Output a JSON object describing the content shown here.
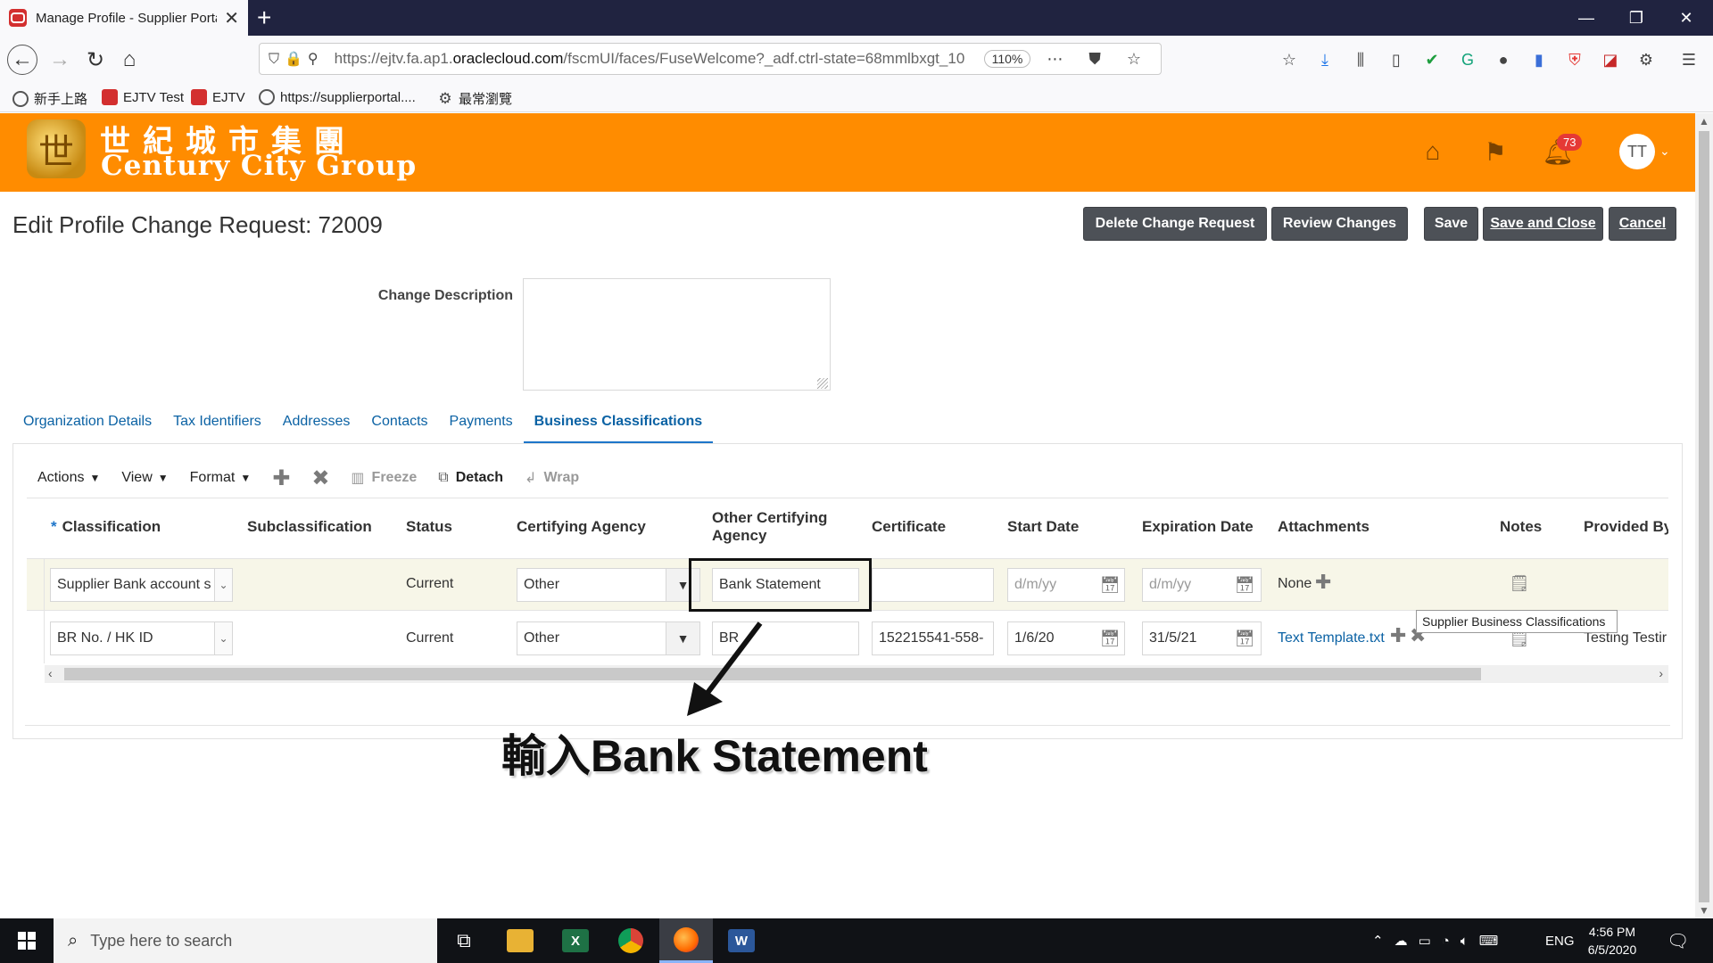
{
  "browser": {
    "tab_title": "Manage Profile - Supplier Portal",
    "url_prefix": "https://ejtv.fa.ap1.",
    "url_domain": "oraclecloud.com",
    "url_suffix": "/fscmUI/faces/FuseWelcome?_adf.ctrl-state=68mmlbxgt_10",
    "zoom": "110%",
    "bookmarks": [
      "新手上路",
      "EJTV Test",
      "EJTV",
      "https://supplierportal....",
      "最常瀏覽"
    ]
  },
  "header": {
    "logo_cn": "世紀城市集團",
    "logo_en": "Century City Group",
    "notification_count": "73",
    "avatar_initials": "TT"
  },
  "page": {
    "title": "Edit Profile Change Request: 72009",
    "buttons": {
      "delete": "Delete Change Request",
      "review": "Review Changes",
      "save": "Save",
      "save_close_u": "S",
      "save_close_rest": "ave and Close",
      "cancel_u": "C",
      "cancel_rest": "ancel"
    },
    "change_description_label": "Change Description",
    "change_description_value": "",
    "tabs": [
      "Organization Details",
      "Tax Identifiers",
      "Addresses",
      "Contacts",
      "Payments",
      "Business Classifications"
    ],
    "active_tab": "Business Classifications"
  },
  "toolbar": {
    "actions": "Actions",
    "view": "View",
    "format": "Format",
    "freeze": "Freeze",
    "detach": "Detach",
    "wrap": "Wrap"
  },
  "table": {
    "required_mark": "*",
    "columns": [
      "Classification",
      "Subclassification",
      "Status",
      "Certifying Agency",
      "Other Certifying Agency",
      "Certificate",
      "Start Date",
      "Expiration Date",
      "Attachments",
      "Notes",
      "Provided By"
    ],
    "rows": [
      {
        "classification": "Supplier Bank account s",
        "subclassification": "",
        "status": "Current",
        "certifying_agency": "Other",
        "other_certifying_agency": "Bank Statement",
        "certificate": "",
        "start_date_placeholder": "d/m/yy",
        "expiration_date_placeholder": "d/m/yy",
        "attachments": "None",
        "provided_by": ""
      },
      {
        "classification": "BR No. / HK ID",
        "subclassification": "",
        "status": "Current",
        "certifying_agency": "Other",
        "other_certifying_agency": "BR",
        "certificate": "152215541-558-",
        "start_date": "1/6/20",
        "expiration_date": "31/5/21",
        "attachments": "Text Template.txt",
        "provided_by": "Testing Testir"
      }
    ],
    "tooltip": "Supplier Business Classifications"
  },
  "annotation": {
    "text": "輸入Bank Statement"
  },
  "taskbar": {
    "search_placeholder": "Type here to search",
    "language": "ENG",
    "time": "4:56 PM",
    "date": "6/5/2020"
  }
}
